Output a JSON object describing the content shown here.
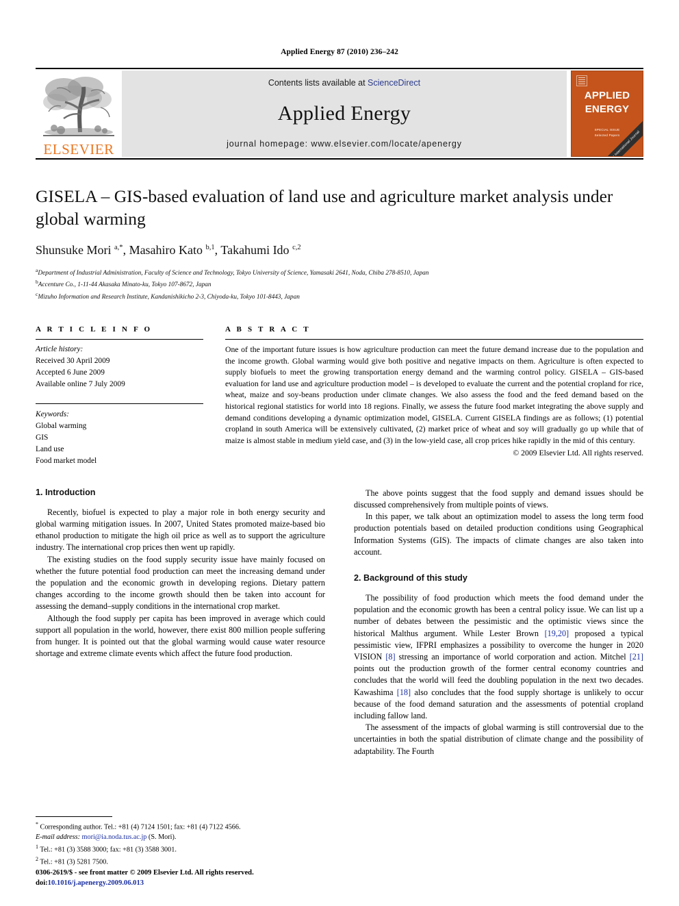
{
  "running_head": "Applied Energy 87 (2010) 236–242",
  "masthead": {
    "elsevier_wordmark": "ELSEVIER",
    "contents_prefix": "Contents lists available at ",
    "contents_link": "ScienceDirect",
    "journal_name": "Applied Energy",
    "homepage": "journal homepage: www.elsevier.com/locate/apenergy",
    "cover": {
      "line1": "APPLIED",
      "line2": "ENERGY",
      "footer1": "SPECIAL ISSUE",
      "footer2": "Selected Papers",
      "ribbon": "An International Journal"
    }
  },
  "title": "GISELA – GIS-based evaluation of land use and agriculture market analysis under global warming",
  "authors_html": "Shunsuke Mori <sup>a,*</sup>, Masahiro Kato <sup>b,1</sup>, Takahumi Ido <sup>c,2</sup>",
  "affiliations": [
    {
      "marker": "a",
      "text": "Department of Industrial Administration, Faculty of Science and Technology, Tokyo University of Science, Yamasaki 2641, Noda, Chiba 278-8510, Japan"
    },
    {
      "marker": "b",
      "text": "Accenture Co., 1-11-44 Akasaka Minato-ku, Tokyo 107-8672, Japan"
    },
    {
      "marker": "c",
      "text": "Mizuho Information and Research Institute, Kandanishikicho 2-3, Chiyoda-ku, Tokyo 101-8443, Japan"
    }
  ],
  "article_info": {
    "heading": "A R T I C L E   I N F O",
    "history_label": "Article history:",
    "history": [
      "Received 30 April 2009",
      "Accepted 6 June 2009",
      "Available online 7 July 2009"
    ],
    "keywords_label": "Keywords:",
    "keywords": [
      "Global warming",
      "GIS",
      "Land use",
      "Food market model"
    ]
  },
  "abstract": {
    "heading": "A B S T R A C T",
    "text": "One of the important future issues is how agriculture production can meet the future demand increase due to the population and the income growth. Global warming would give both positive and negative impacts on them. Agriculture is often expected to supply biofuels to meet the growing transportation energy demand and the warming control policy. GISELA – GIS-based evaluation for land use and agriculture production model – is developed to evaluate the current and the potential cropland for rice, wheat, maize and soy-beans production under climate changes. We also assess the food and the feed demand based on the historical regional statistics for world into 18 regions. Finally, we assess the future food market integrating the above supply and demand conditions developing a dynamic optimization model, GISELA. Current GISELA findings are as follows; (1) potential cropland in south America will be extensively cultivated, (2) market price of wheat and soy will gradually go up while that of maize is almost stable in medium yield case, and (3) in the low-yield case, all crop prices hike rapidly in the mid of this century.",
    "copyright": "© 2009 Elsevier Ltd. All rights reserved."
  },
  "body": {
    "left": {
      "section1_heading": "1. Introduction",
      "p1": "Recently, biofuel is expected to play a major role in both energy security and global warming mitigation issues. In 2007, United States promoted maize-based bio ethanol production to mitigate the high oil price as well as to support the agriculture industry. The international crop prices then went up rapidly.",
      "p2": "The existing studies on the food supply security issue have mainly focused on whether the future potential food production can meet the increasing demand under the population and the economic growth in developing regions. Dietary pattern changes according to the income growth should then be taken into account for assessing the demand–supply conditions in the international crop market.",
      "p3": "Although the food supply per capita has been improved in average which could support all population in the world, however, there exist 800 million people suffering from hunger. It is pointed out that the global warming would cause water resource shortage and extreme climate events which affect the future food production."
    },
    "right": {
      "p1": "The above points suggest that the food supply and demand issues should be discussed comprehensively from multiple points of views.",
      "p2": "In this paper, we talk about an optimization model to assess the long term food production potentials based on detailed production conditions using Geographical Information Systems (GIS). The impacts of climate changes are also taken into account.",
      "section2_heading": "2. Background of this study",
      "p3_part1": "The possibility of food production which meets the food demand under the population and the economic growth has been a central policy issue. We can list up a number of debates between the pessimistic and the optimistic views since the historical Malthus argument. While Lester Brown ",
      "p3_ref1": "[19,20]",
      "p3_part2": " proposed a typical pessimistic view, IFPRI emphasizes a possibility to overcome the hunger in 2020 VISION ",
      "p3_ref2": "[8]",
      "p3_part3": " stressing an importance of world corporation and action. Mitchel ",
      "p3_ref3": "[21]",
      "p3_part4": " points out the production growth of the former central economy countries and concludes that the world will feed the doubling population in the next two decades. Kawashima ",
      "p3_ref4": "[18]",
      "p3_part5": " also concludes that the food supply shortage is unlikely to occur because of the food demand saturation and the assessments of potential cropland including fallow land.",
      "p4": "The assessment of the impacts of global warming is still controversial due to the uncertainties in both the spatial distribution of climate change and the possibility of adaptability. The Fourth"
    }
  },
  "footnotes": {
    "corresponding": "Corresponding author. Tel.: +81 (4) 7124 1501; fax: +81 (4) 7122 4566.",
    "email_label": "E-mail address:",
    "email": "mori@ia.noda.tus.ac.jp",
    "email_suffix": "(S. Mori).",
    "note1": "Tel.: +81 (3) 3588 3000; fax: +81 (3) 3588 3001.",
    "note2": "Tel.: +81 (3) 5281 7500."
  },
  "imprint": {
    "line1": "0306-2619/$ - see front matter © 2009 Elsevier Ltd. All rights reserved.",
    "doi_label": "doi:",
    "doi": "10.1016/j.apenergy.2009.06.013"
  }
}
